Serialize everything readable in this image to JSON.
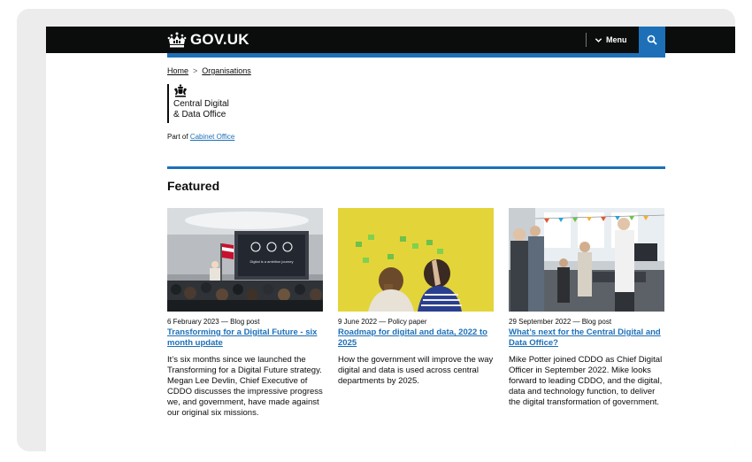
{
  "header": {
    "logo_text": "GOV.UK",
    "menu_label": "Menu"
  },
  "breadcrumb": {
    "home": "Home",
    "separator": ">",
    "organisations": "Organisations"
  },
  "organisation": {
    "line1": "Central Digital",
    "line2": "& Data Office"
  },
  "part_of": {
    "prefix": "Part of",
    "link": "Cabinet Office"
  },
  "featured": {
    "heading": "Featured",
    "cards": [
      {
        "meta": "6 February 2023 — Blog post",
        "title": "Transforming for a Digital Future - six month update",
        "description": "It’s six months since we launched the Transforming for a Digital Future strategy. Megan Lee Devlin, Chief Executive of CDDO discusses the impressive progress we, and government, have made against our original six missions.",
        "screen_text": "Digital is a ambition journey",
        "image": "conference-audience-image"
      },
      {
        "meta": "9 June 2022 — Policy paper",
        "title": "Roadmap for digital and data, 2022 to 2025",
        "description": "How the government will improve the way digital and data is used across central departments by 2025.",
        "image": "post-it-wall-image"
      },
      {
        "meta": "29 September 2022 — Blog post",
        "title": "What’s next for the Central Digital and Data Office?",
        "description": "Mike Potter joined CDDO as Chief Digital Officer in September 2022. Mike looks forward to leading CDDO, and the digital, data and technology function, to deliver the digital transformation of government.",
        "image": "office-meeting-image"
      }
    ]
  },
  "colors": {
    "header_bg": "#0b0c0c",
    "brand_blue": "#1d70b8",
    "text": "#0b0c0c"
  }
}
